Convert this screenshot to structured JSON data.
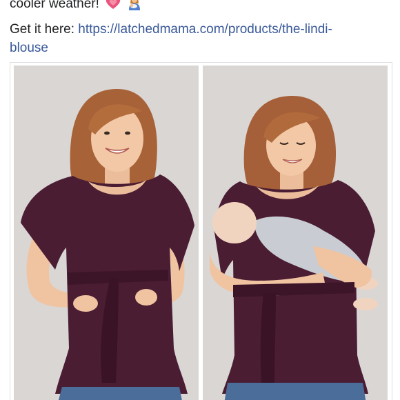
{
  "post": {
    "line1": "cooler weather!",
    "line2_prefix": "Get it here: ",
    "link_line1": "https://latchedmama.com/products/the-lindi-",
    "link_line2": "blouse"
  },
  "icons": {
    "heart": "sparkling-heart-icon",
    "mother": "breastfeeding-icon"
  },
  "colors": {
    "text": "#1c1e21",
    "link": "#385898",
    "blouse": "#4a1d33",
    "backdrop": "#dad6d4",
    "jeans": "#4a6d9a"
  }
}
